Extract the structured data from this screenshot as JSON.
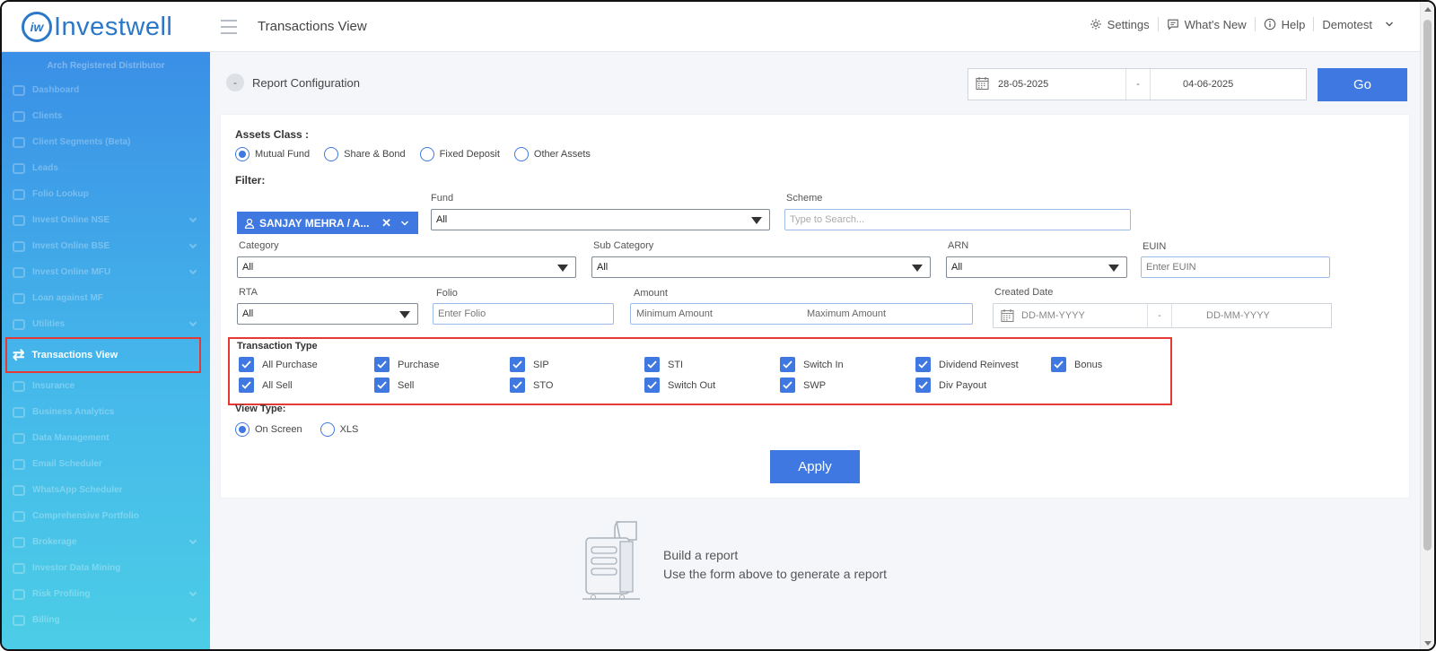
{
  "header": {
    "logo_text": "Investwell",
    "logo_mark": "iw",
    "page_title": "Transactions View",
    "settings": "Settings",
    "whats_new": "What's New",
    "help": "Help",
    "user": "Demotest"
  },
  "sidebar": {
    "title": "Arch Registered Distributor",
    "items": [
      {
        "label": "Dashboard",
        "chevron": false
      },
      {
        "label": "Clients",
        "chevron": false
      },
      {
        "label": "Client Segments (Beta)",
        "chevron": false
      },
      {
        "label": "Leads",
        "chevron": false
      },
      {
        "label": "Folio Lookup",
        "chevron": false
      },
      {
        "label": "Invest Online NSE",
        "chevron": true
      },
      {
        "label": "Invest Online BSE",
        "chevron": true
      },
      {
        "label": "Invest Online MFU",
        "chevron": true
      },
      {
        "label": "Loan against MF",
        "chevron": false
      },
      {
        "label": "Utilities",
        "chevron": true
      }
    ],
    "active_item": "Transactions View",
    "items_after": [
      {
        "label": "Insurance",
        "chevron": false
      },
      {
        "label": "Business Analytics",
        "chevron": false
      },
      {
        "label": "Data Management",
        "chevron": false
      },
      {
        "label": "Email Scheduler",
        "chevron": false
      },
      {
        "label": "WhatsApp Scheduler",
        "chevron": false
      },
      {
        "label": "Comprehensive Portfolio",
        "chevron": false
      },
      {
        "label": "Brokerage",
        "chevron": true
      },
      {
        "label": "Investor Data Mining",
        "chevron": false
      },
      {
        "label": "Risk Profiling",
        "chevron": true
      },
      {
        "label": "Billing",
        "chevron": true
      }
    ]
  },
  "config": {
    "collapse_symbol": "-",
    "label": "Report Configuration",
    "date_from": "28-05-2025",
    "date_sep": "-",
    "date_to": "04-06-2025",
    "go_label": "Go"
  },
  "form": {
    "assets_class_label": "Assets Class :",
    "assets_options": [
      "Mutual Fund",
      "Share & Bond",
      "Fixed Deposit",
      "Other Assets"
    ],
    "assets_selected": "Mutual Fund",
    "filter_label": "Filter:",
    "client_chip": "SANJAY MEHRA / A...",
    "fund_label": "Fund",
    "fund_value": "All",
    "scheme_label": "Scheme",
    "scheme_placeholder": "Type to Search...",
    "category_label": "Category",
    "category_value": "All",
    "subcategory_label": "Sub Category",
    "subcategory_value": "All",
    "arn_label": "ARN",
    "arn_value": "All",
    "euin_label": "EUIN",
    "euin_placeholder": "Enter EUIN",
    "rta_label": "RTA",
    "rta_value": "All",
    "folio_label": "Folio",
    "folio_placeholder": "Enter Folio",
    "amount_label": "Amount",
    "amount_min_placeholder": "Minimum Amount",
    "amount_max_placeholder": "Maximum Amount",
    "created_date_label": "Created Date",
    "created_from_placeholder": "DD-MM-YYYY",
    "created_sep": "-",
    "created_to_placeholder": "DD-MM-YYYY",
    "transaction_type_label": "Transaction Type",
    "transaction_types_row1": [
      "All Purchase",
      "Purchase",
      "SIP",
      "STI",
      "Switch In",
      "Dividend Reinvest",
      "Bonus"
    ],
    "transaction_types_row2": [
      "All Sell",
      "Sell",
      "STO",
      "Switch Out",
      "SWP",
      "Div Payout"
    ],
    "view_type_label": "View Type:",
    "view_options": [
      "On Screen",
      "XLS"
    ],
    "view_selected": "On Screen",
    "apply_label": "Apply"
  },
  "empty_state": {
    "title": "Build a report",
    "subtitle": "Use the form above to generate a report"
  }
}
